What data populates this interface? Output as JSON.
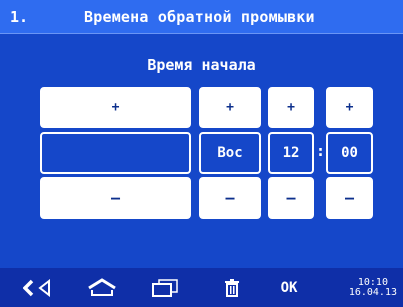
{
  "header": {
    "menu_number": "1.",
    "title": "Времена обратной промывки"
  },
  "section": {
    "label": "Время начала"
  },
  "controls": {
    "plus_symbol": "+",
    "minus_symbol": "–",
    "program_value": "",
    "day_value": "Вос",
    "hour_value": "12",
    "minute_value": "00",
    "separator": ":"
  },
  "bottom_bar": {
    "ok_label": "OK",
    "time": "10:10",
    "date": "16.04.13",
    "icons": [
      "back-icon",
      "home-icon",
      "windows-icon",
      "trash-icon"
    ]
  },
  "colors": {
    "background": "#1547c9",
    "title_bar": "#2f6cf0",
    "bottom_bar": "#0f2fa8",
    "button_face": "#ffffff",
    "button_text": "#0c2f8c"
  }
}
